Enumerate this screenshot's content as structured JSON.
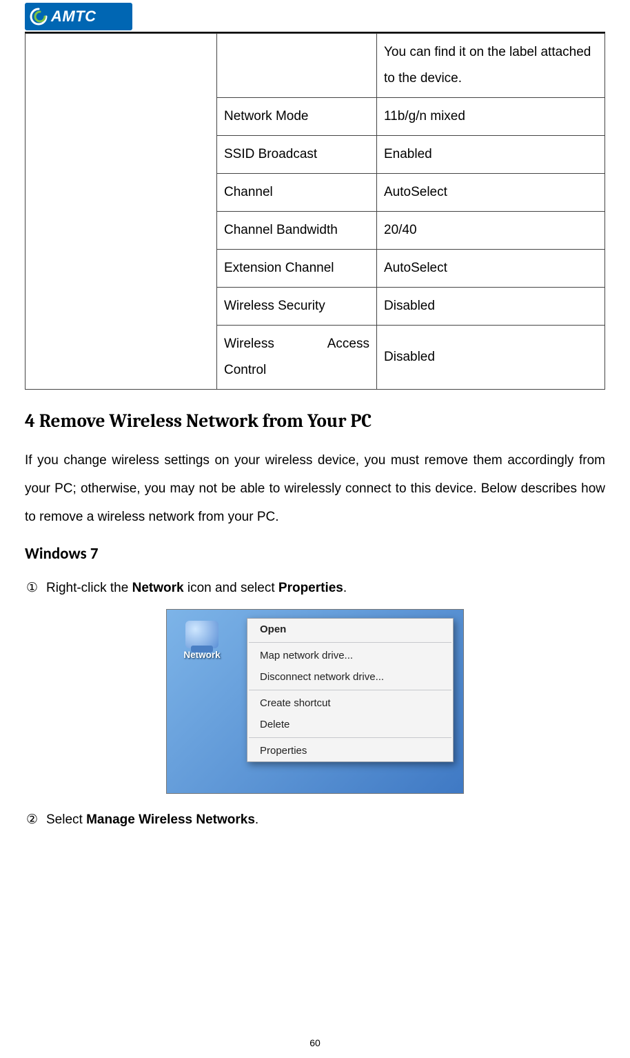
{
  "brand": {
    "name": "AMTC"
  },
  "settings_table": {
    "note": "You can find it on the label attached to the device.",
    "rows": [
      {
        "label": "Network Mode",
        "value": "11b/g/n mixed"
      },
      {
        "label": "SSID Broadcast",
        "value": "Enabled"
      },
      {
        "label": "Channel",
        "value": "AutoSelect"
      },
      {
        "label": "Channel Bandwidth",
        "value": "20/40"
      },
      {
        "label": "Extension Channel",
        "value": "AutoSelect"
      },
      {
        "label": "Wireless Security",
        "value": "Disabled"
      },
      {
        "label_a": "Wireless",
        "label_b": "Access",
        "label_c": "Control",
        "value": "Disabled"
      }
    ]
  },
  "section_heading": "4 Remove Wireless Network from Your PC",
  "section_body": "If you change wireless settings on your wireless device, you must remove them accordingly from your PC; otherwise, you may not be able to wirelessly connect to this device. Below describes how to remove a wireless network from your PC.",
  "subsection": "Windows 7",
  "steps": {
    "s1": {
      "num": "①",
      "pre": "Right-click the ",
      "b1": "Network",
      "mid": " icon and select ",
      "b2": "Properties",
      "post": "."
    },
    "s2": {
      "num": "②",
      "pre": "Select ",
      "b1": "Manage Wireless Networks",
      "post": "."
    }
  },
  "screenshot": {
    "icon_label": "Network",
    "menu": {
      "items": [
        {
          "text": "Open",
          "bold": true
        },
        {
          "text": "Map network drive..."
        },
        {
          "text": "Disconnect network drive..."
        },
        {
          "text": "Create shortcut"
        },
        {
          "text": "Delete"
        },
        {
          "text": "Properties"
        }
      ]
    }
  },
  "page_number": "60"
}
